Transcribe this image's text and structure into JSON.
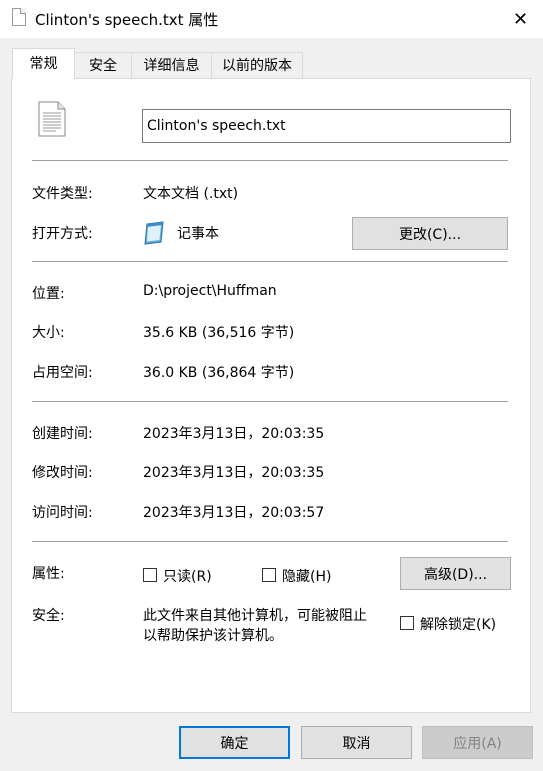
{
  "window": {
    "title": "Clinton's speech.txt 属性",
    "close_glyph": "✕"
  },
  "tabs": [
    {
      "label": "常规",
      "active": true
    },
    {
      "label": "安全"
    },
    {
      "label": "详细信息"
    },
    {
      "label": "以前的版本"
    }
  ],
  "general": {
    "file_name": "Clinton's speech.txt",
    "file_type_label": "文件类型:",
    "file_type_value": "文本文档 (.txt)",
    "open_with_label": "打开方式:",
    "open_with_value": "记事本",
    "change_button": "更改(C)...",
    "location_label": "位置:",
    "location_value": "D:\\project\\Huffman",
    "size_label": "大小:",
    "size_value": "35.6 KB (36,516 字节)",
    "size_on_disk_label": "占用空间:",
    "size_on_disk_value": "36.0 KB (36,864 字节)",
    "created_label": "创建时间:",
    "created_value": "2023年3月13日，20:03:35",
    "modified_label": "修改时间:",
    "modified_value": "2023年3月13日，20:03:35",
    "accessed_label": "访问时间:",
    "accessed_value": "2023年3月13日，20:03:57",
    "attributes_label": "属性:",
    "readonly_label": "只读(R)",
    "hidden_label": "隐藏(H)",
    "advanced_button": "高级(D)...",
    "security_label": "安全:",
    "security_line1": "此文件来自其他计算机，可能被阻止",
    "security_line2": "以帮助保护该计算机。",
    "unblock_label": "解除锁定(K)"
  },
  "footer": {
    "ok": "确定",
    "cancel": "取消",
    "apply": "应用(A)"
  },
  "colors": {
    "accent": "#0078d7"
  }
}
